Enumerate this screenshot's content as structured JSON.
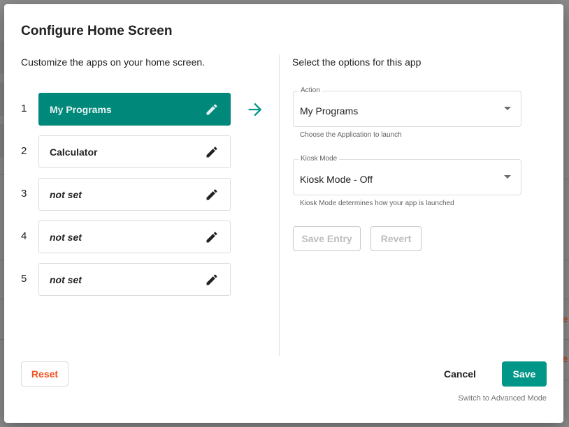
{
  "dialog": {
    "title": "Configure Home Screen",
    "left_subtitle": "Customize the apps on your home screen.",
    "right_subtitle": "Select the options for this app"
  },
  "slots": [
    {
      "number": "1",
      "label": "My Programs",
      "set": true,
      "active": true
    },
    {
      "number": "2",
      "label": "Calculator",
      "set": true,
      "active": false
    },
    {
      "number": "3",
      "label": "not set",
      "set": false,
      "active": false
    },
    {
      "number": "4",
      "label": "not set",
      "set": false,
      "active": false
    },
    {
      "number": "5",
      "label": "not set",
      "set": false,
      "active": false
    }
  ],
  "icons": {
    "edit": "pencil-icon",
    "selected_arrow": "arrow-right-icon",
    "dropdown": "caret-down-icon"
  },
  "form": {
    "action": {
      "legend": "Action",
      "value": "My Programs",
      "helper": "Choose the Application to launch"
    },
    "kiosk": {
      "legend": "Kiosk Mode",
      "value": "Kiosk Mode - Off",
      "helper": "Kiosk Mode determines how your app is launched"
    },
    "save_entry_label": "Save Entry",
    "revert_label": "Revert"
  },
  "footer": {
    "reset_label": "Reset",
    "cancel_label": "Cancel",
    "save_label": "Save",
    "advanced_link": "Switch to Advanced Mode"
  },
  "background": {
    "partial_text": "e"
  },
  "colors": {
    "accent": "#009688",
    "active_slot": "#00897b",
    "danger": "#f4511e"
  }
}
